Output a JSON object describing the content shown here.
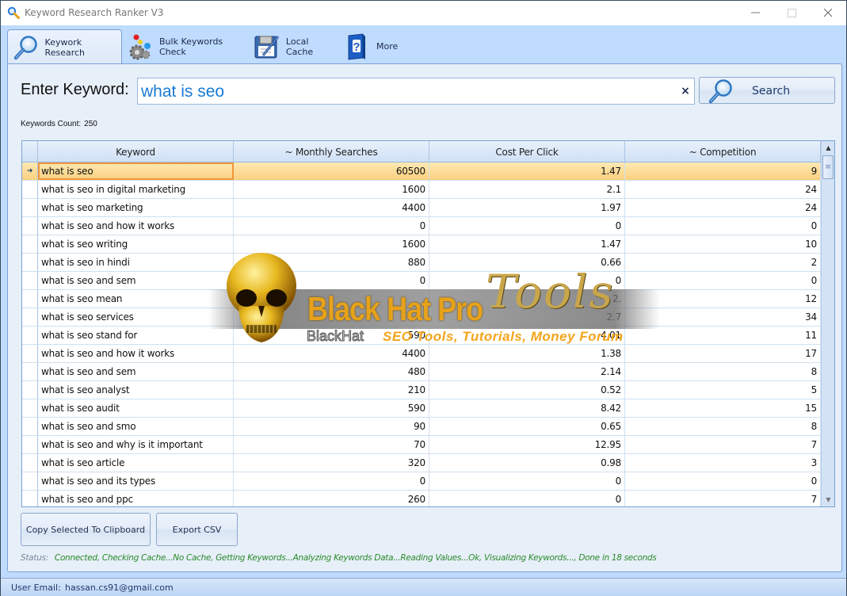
{
  "window": {
    "title": "Keyword Research Ranker V3",
    "controls": {
      "minimize": "—",
      "maximize": "☐",
      "close": "✕"
    }
  },
  "tabs": [
    {
      "label": "Keywork Research",
      "icon": "magnifier-icon",
      "active": true
    },
    {
      "label": "Bulk Keywords Check",
      "icon": "gears-icon",
      "active": false
    },
    {
      "label": "Local Cache",
      "icon": "disk-edit-icon",
      "active": false
    },
    {
      "label": "More",
      "icon": "help-book-icon",
      "active": false
    }
  ],
  "search": {
    "label": "Enter Keyword:",
    "value": "what is seo",
    "clear_icon": "×",
    "button_label": "Search"
  },
  "keywords_count": {
    "label": "Keywords Count:",
    "value": "250"
  },
  "grid": {
    "columns": [
      "Keyword",
      "~ Monthly Searches",
      "Cost Per Click",
      "~ Competition"
    ],
    "selected_indicator": "➜",
    "rows": [
      {
        "keyword": "what is seo",
        "monthly": "60500",
        "cpc": "1.47",
        "competition": "9",
        "selected": true
      },
      {
        "keyword": "what is seo in digital marketing",
        "monthly": "1600",
        "cpc": "2.1",
        "competition": "24"
      },
      {
        "keyword": "what is seo marketing",
        "monthly": "4400",
        "cpc": "1.97",
        "competition": "24"
      },
      {
        "keyword": "what is seo and how it works",
        "monthly": "0",
        "cpc": "0",
        "competition": "0"
      },
      {
        "keyword": "what is seo writing",
        "monthly": "1600",
        "cpc": "1.47",
        "competition": "10"
      },
      {
        "keyword": "what is seo in hindi",
        "monthly": "880",
        "cpc": "0.66",
        "competition": "2"
      },
      {
        "keyword": "what is seo and sem",
        "monthly": "0",
        "cpc": "0",
        "competition": "0"
      },
      {
        "keyword": "what is seo mean",
        "monthly": "",
        "cpc": "2.",
        "competition": "12"
      },
      {
        "keyword": "what is seo services",
        "monthly": "",
        "cpc": "2.7",
        "competition": "34"
      },
      {
        "keyword": "what is seo stand for",
        "monthly": "590",
        "cpc": "4.01",
        "competition": "11"
      },
      {
        "keyword": "what is seo and how it works",
        "monthly": "4400",
        "cpc": "1.38",
        "competition": "17"
      },
      {
        "keyword": "what is seo and sem",
        "monthly": "480",
        "cpc": "2.14",
        "competition": "8"
      },
      {
        "keyword": "what is seo analyst",
        "monthly": "210",
        "cpc": "0.52",
        "competition": "5"
      },
      {
        "keyword": "what is seo audit",
        "monthly": "590",
        "cpc": "8.42",
        "competition": "15"
      },
      {
        "keyword": "what is seo and smo",
        "monthly": "90",
        "cpc": "0.65",
        "competition": "8"
      },
      {
        "keyword": "what is seo and why is it important",
        "monthly": "70",
        "cpc": "12.95",
        "competition": "7"
      },
      {
        "keyword": "what is seo article",
        "monthly": "320",
        "cpc": "0.98",
        "competition": "3"
      },
      {
        "keyword": "what is seo and its types",
        "monthly": "0",
        "cpc": "0",
        "competition": "0"
      },
      {
        "keyword": "what is seo and ppc",
        "monthly": "260",
        "cpc": "0",
        "competition": "7"
      }
    ],
    "scroll_up": "▲",
    "scroll_down": "▼",
    "scroll_grip": "≡"
  },
  "buttons": {
    "copy_label": "Copy Selected To Clipboard",
    "export_label": "Export CSV"
  },
  "status": {
    "label": "Status:",
    "text": "Connected, Checking Cache...No Cache, Getting Keywords...Analyzing Keywords Data...Reading Values...Ok, Visualizing Keywords..., Done in 18 seconds"
  },
  "statusbar": {
    "email_label": "User Email:",
    "email_value": "hassan.cs91@gmail.com"
  },
  "watermark": {
    "main": "Black Hat Pro",
    "script": "Tools",
    "sub_left": "BlackHat",
    "sub_right": "SEO Tools, Tutorials, Money Forum"
  }
}
